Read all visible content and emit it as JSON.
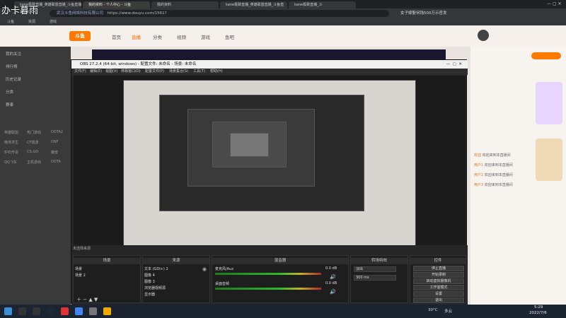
{
  "watermark": "办卡暮雨",
  "browser": {
    "tabs": [
      {
        "label": "kane极致直播_英雄联盟直播_斗鱼直播"
      },
      {
        "label": "我的资料 - 个人中心 - 斗鱼"
      },
      {
        "label": "我的资料"
      },
      {
        "label": "kane极致直播_英雄联盟直播_斗鱼直"
      },
      {
        "label": "kane极致直播_斗"
      }
    ],
    "url": "https://www.douyu.com/1561?",
    "url_site": "武汉斗鱼网络科技有限公司",
    "bookmarks": [
      "斗鱼",
      "资源",
      "游戏"
    ],
    "promo": "女子嫁娶何钱500万示官发"
  },
  "site": {
    "logo": "斗鱼",
    "nav": [
      "首页",
      "直播",
      "分类",
      "视频",
      "游戏",
      "鱼吧"
    ],
    "left": [
      "我的关注",
      "排行榜",
      "历史记录",
      "分类",
      "赛事"
    ],
    "left_grid": [
      "英雄联盟",
      "热门游戏",
      "DOTA2",
      "绝地求生",
      "CF端游",
      "DNF",
      "炉石传说",
      "CS:GO",
      "魔兽",
      "QQ飞车",
      "主机游戏",
      "DOTA"
    ],
    "chat": [
      {
        "name": "欢迎",
        "text": "欢迎来到本直播间"
      },
      {
        "name": "用户1",
        "text": "欢迎来到本直播间"
      },
      {
        "name": "用户2",
        "text": "欢迎来到本直播间"
      },
      {
        "name": "用户3",
        "text": "欢迎来到本直播间"
      }
    ]
  },
  "obs": {
    "title": "OBS 27.2.4 (64-bit, windows) - 配置文件: 未命名 - 场景: 未命名",
    "menu": [
      "文件(F)",
      "编辑(E)",
      "视图(V)",
      "停靠窗口(D)",
      "配置文件(P)",
      "场景集合(S)",
      "工具(T)",
      "帮助(H)"
    ],
    "scenes_title": "场景",
    "scenes": [
      "场景",
      "场景 2"
    ],
    "sources_title": "来源",
    "sources": [
      "文本 (GDI+) 2",
      "图像 4",
      "图像 3",
      "浏览器视频源",
      "显示器"
    ],
    "mixer_title": "混音器",
    "mixer_tracks": [
      "麦克风/Aux",
      "桌面音频"
    ],
    "mixer_db": [
      "0.0 dB",
      "0.0 dB"
    ],
    "transitions_title": "转场特效",
    "transition_name": "淡出",
    "transition_duration": "300 ms",
    "controls_title": "控件",
    "controls": [
      "停止直播",
      "开始录制",
      "启动虚拟摄像机",
      "工作室模式",
      "设置",
      "退出"
    ],
    "status_bar": "未选择来源"
  },
  "taskbar": {
    "time": "5:29",
    "date": "2022/7/6",
    "temp": "30°C",
    "weather": "多云"
  }
}
